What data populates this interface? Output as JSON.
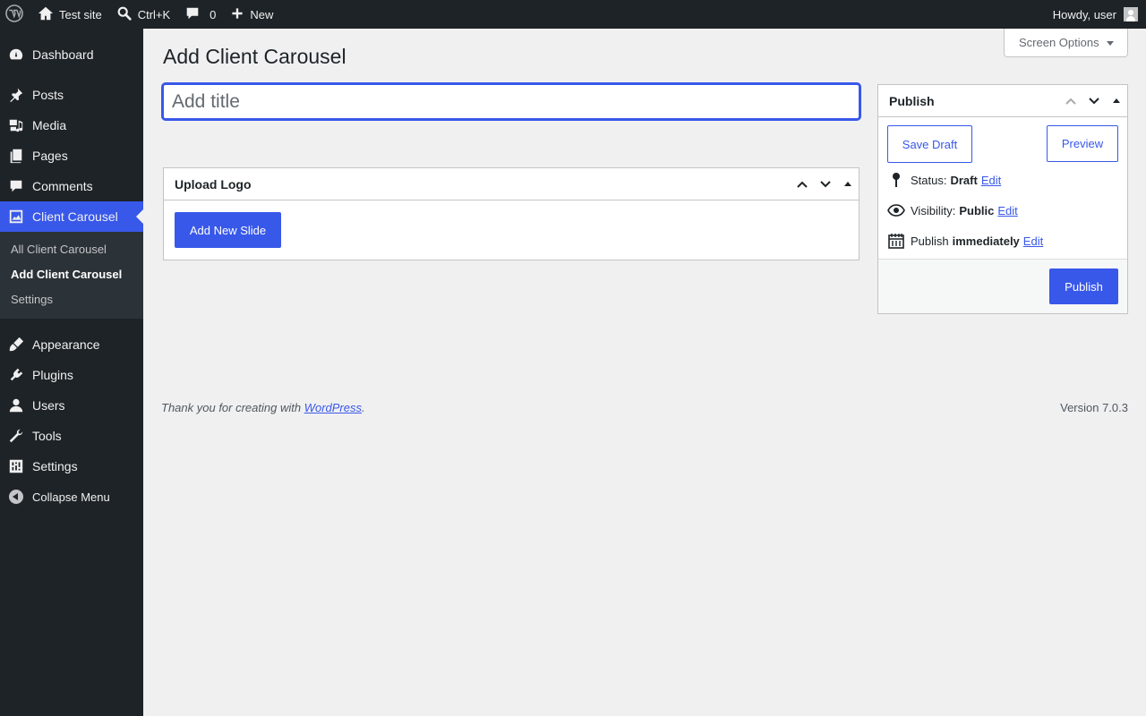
{
  "adminbar": {
    "site_name": "Test site",
    "search_shortcut": "Ctrl+K",
    "comments_count": "0",
    "new_label": "New",
    "greeting": "Howdy, user",
    "icons": [
      "wordpress-logo-icon",
      "home-icon",
      "search-icon",
      "comment-icon",
      "plus-icon",
      "avatar"
    ]
  },
  "sidebar": {
    "items": [
      {
        "label": "Dashboard",
        "icon": "dashboard-icon"
      },
      {
        "label": "Posts",
        "icon": "pin-icon"
      },
      {
        "label": "Media",
        "icon": "media-icon"
      },
      {
        "label": "Pages",
        "icon": "pages-icon"
      },
      {
        "label": "Comments",
        "icon": "comment-icon"
      },
      {
        "label": "Client Carousel",
        "icon": "image-icon",
        "current": true
      },
      {
        "label": "Appearance",
        "icon": "brush-icon"
      },
      {
        "label": "Plugins",
        "icon": "plugin-icon"
      },
      {
        "label": "Users",
        "icon": "user-icon"
      },
      {
        "label": "Tools",
        "icon": "wrench-icon"
      },
      {
        "label": "Settings",
        "icon": "settings-icon"
      }
    ],
    "submenu": [
      "All Client Carousel",
      "Add Client Carousel",
      "Settings"
    ],
    "collapse_label": "Collapse Menu"
  },
  "screen_options": "Screen Options",
  "page_title": "Add Client Carousel",
  "title_input": {
    "placeholder": "Add title",
    "value": ""
  },
  "upload_box": {
    "title": "Upload Logo",
    "add_slide_label": "Add New Slide"
  },
  "publish_box": {
    "title": "Publish",
    "save_draft_label": "Save Draft",
    "preview_label": "Preview",
    "status_label": "Status:",
    "status_value": "Draft",
    "visibility_label": "Visibility:",
    "visibility_value": "Public",
    "publish_label": "Publish",
    "publish_value": "immediately",
    "edit_label": "Edit",
    "publish_button_label": "Publish"
  },
  "footer": {
    "thanks_prefix": "Thank you for creating with ",
    "link_text": "WordPress",
    "thanks_suffix": ".",
    "version": "Version 7.0.3"
  },
  "colors": {
    "accent": "#3858e9",
    "adminbar": "#1d2327",
    "background": "#f0f0f1"
  }
}
